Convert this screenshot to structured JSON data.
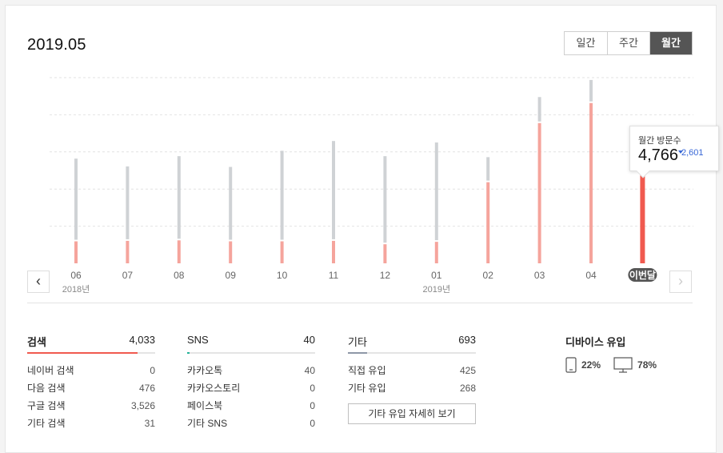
{
  "header": {
    "period": "2019.05"
  },
  "tabs": [
    {
      "label": "일간",
      "active": false
    },
    {
      "label": "주간",
      "active": false
    },
    {
      "label": "월간",
      "active": true
    }
  ],
  "tooltip": {
    "label": "월간 방문수",
    "value": "4,766",
    "diff": "2,601"
  },
  "colors": {
    "search": "#f05a4f",
    "sns": "#26b49a",
    "other": "#8e98a7",
    "bar_gray": "#cfd2d5",
    "bar_red": "#f5a49c",
    "current_red": "#f05a4f",
    "current_gray": "#8e98a7"
  },
  "chart_data": {
    "type": "bar",
    "categories": [
      "06",
      "07",
      "08",
      "09",
      "10",
      "11",
      "12",
      "01",
      "02",
      "03",
      "04",
      "이번달"
    ],
    "year_labels": [
      {
        "index": 0,
        "label": "2018년"
      },
      {
        "index": 7,
        "label": "2019년"
      }
    ],
    "series": [
      {
        "values": [
          450,
          460,
          470,
          450,
          450,
          460,
          390,
          440,
          1660,
          2870,
          3280,
          2020
        ]
      },
      {
        "values": [
          1660,
          1490,
          1690,
          1490,
          1820,
          2010,
          1770,
          2000,
          480,
          500,
          440,
          380
        ]
      }
    ],
    "stacked": true,
    "highlight_index": 11,
    "ylim": [
      0,
      3800
    ],
    "gridlines": 5,
    "grid": true,
    "legend": "none"
  },
  "sections": {
    "search": {
      "title": "검색",
      "total": "4,033",
      "share": 0.86,
      "items": [
        {
          "label": "네이버 검색",
          "value": "0"
        },
        {
          "label": "다음 검색",
          "value": "476"
        },
        {
          "label": "구글 검색",
          "value": "3,526"
        },
        {
          "label": "기타 검색",
          "value": "31"
        }
      ]
    },
    "sns": {
      "title": "SNS",
      "total": "40",
      "share": 0.02,
      "items": [
        {
          "label": "카카오톡",
          "value": "40"
        },
        {
          "label": "카카오스토리",
          "value": "0"
        },
        {
          "label": "페이스북",
          "value": "0"
        },
        {
          "label": "기타 SNS",
          "value": "0"
        }
      ]
    },
    "other": {
      "title": "기타",
      "total": "693",
      "share": 0.15,
      "items": [
        {
          "label": "직접 유입",
          "value": "425"
        },
        {
          "label": "기타 유입",
          "value": "268"
        }
      ],
      "button": "기타 유입 자세히 보기"
    }
  },
  "devices": {
    "title": "디바이스 유입",
    "mobile": {
      "icon": "mobile-icon",
      "pct": "22%"
    },
    "pc": {
      "icon": "monitor-icon",
      "pct": "78%"
    }
  }
}
